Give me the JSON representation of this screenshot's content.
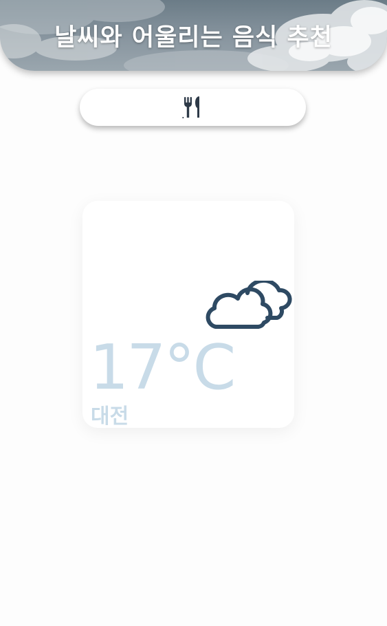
{
  "header": {
    "title": "날씨와 어울리는 음식 추천"
  },
  "food_button": {
    "icon": "fork-knife-icon"
  },
  "weather": {
    "temperature": "17°C",
    "city": "대전",
    "icon": "cloud-icon",
    "icon_color": "#2e4a63",
    "text_color": "#c8dbe8"
  },
  "colors": {
    "background": "#fdfdfd",
    "card": "#ffffff"
  }
}
